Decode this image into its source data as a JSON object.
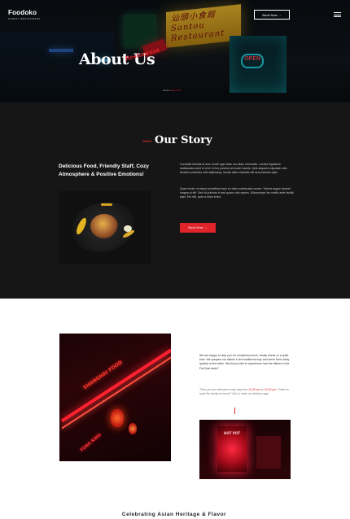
{
  "header": {
    "logo": "Foodoko",
    "logo_subtitle": "FINEST RESTAURANT",
    "book_button": "Book Now →",
    "menu_icon": "hamburger-icon"
  },
  "hero": {
    "title": "About Us",
    "script": "Restaurant",
    "breadcrumb_home": "Home",
    "breadcrumb_sep": "/",
    "breadcrumb_current": "About Us",
    "sign_text": "汕頭小食館 Santou Restaurant",
    "open_sign": "OPEN"
  },
  "story": {
    "title": "Our Story",
    "heading": "Delicious Food, Friendly Staff, Cozy Atmosphere & Positive Emotions!",
    "paragraph1": "Convallis lobortis et arcu morbi eget vitae orci diam venenatis. Lacinia dignissim malesuada amet et ut et. Id leo pulvinar at morbi mauris. Quis aliquam vulputate odio faucibus pharetra odio adipiscing. Iaculis diam molestie elit sed pharetra eget.",
    "paragraph2": "Quam tortor ut neque penatibus risus eu diam malesuada ornare. Viverra augue laoreet magna ut elit. Sed sit pulvinar id sed quam odio sapien. Ullamcorper leo mattis ante facilisi eget. Est nisl, quis ut diam tortor.",
    "book_button": "Book Now →"
  },
  "gallery": {
    "paragraph1": "We are happy to help you for a business lunch, family dinner or a quiet time. We prepare our dishes in the traditional way and serve them fairly quickly on the table. Would you like to experience how the dishes in the Far East taste?",
    "paragraph2_pre": "Then you are welcome every day from ",
    "paragraph2_hl1": "11:00 am",
    "paragraph2_mid": " to ",
    "paragraph2_hl2": "10:00 pm",
    "paragraph2_post": ". Prefer to spoil the family at home? Call or order via delivery app!",
    "neon_sign": "SHANGHAI FOOD",
    "neon_sign2": "FUNG KING",
    "red_sign": "HOT POT"
  },
  "bottom": {
    "title": "Celebrating Asian Heritage & Flavor"
  },
  "colors": {
    "accent": "#e0242a",
    "dark_bg": "#161616"
  }
}
